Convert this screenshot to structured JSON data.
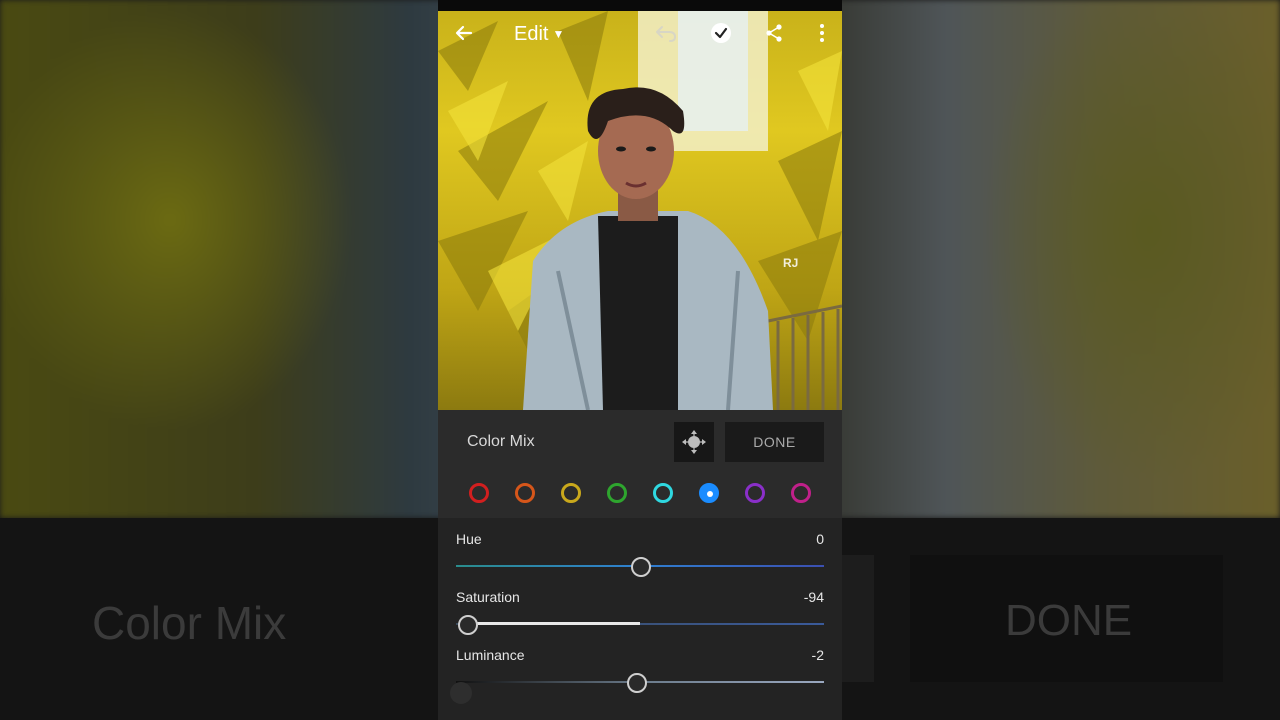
{
  "top_bar": {
    "edit_label": "Edit"
  },
  "icons": {
    "back": "arrow-left-icon",
    "edit_caret": "caret-down-icon",
    "undo": "undo-icon",
    "apply": "checkmark-icon",
    "share": "share-icon",
    "more": "more-vertical-icon",
    "target": "targeted-adjustment-icon"
  },
  "panel": {
    "title": "Color Mix",
    "done_label": "DONE",
    "swatches": [
      {
        "color": "#d21f1f",
        "selected": false
      },
      {
        "color": "#d6561a",
        "selected": false
      },
      {
        "color": "#c9a81c",
        "selected": false
      },
      {
        "color": "#2ea52e",
        "selected": false
      },
      {
        "color": "#2fd8e0",
        "selected": false
      },
      {
        "color": "#1a8cff",
        "selected": true
      },
      {
        "color": "#8a2fc9",
        "selected": false
      },
      {
        "color": "#c0208a",
        "selected": false
      }
    ]
  },
  "sliders": {
    "hue": {
      "label": "Hue",
      "value": "0",
      "num": 0
    },
    "saturation": {
      "label": "Saturation",
      "value": "-94",
      "num": -94
    },
    "luminance": {
      "label": "Luminance",
      "value": "-2",
      "num": -2
    }
  },
  "backdrop": {
    "title": "Color Mix",
    "done_label": "DONE"
  },
  "watermark": "RJ"
}
